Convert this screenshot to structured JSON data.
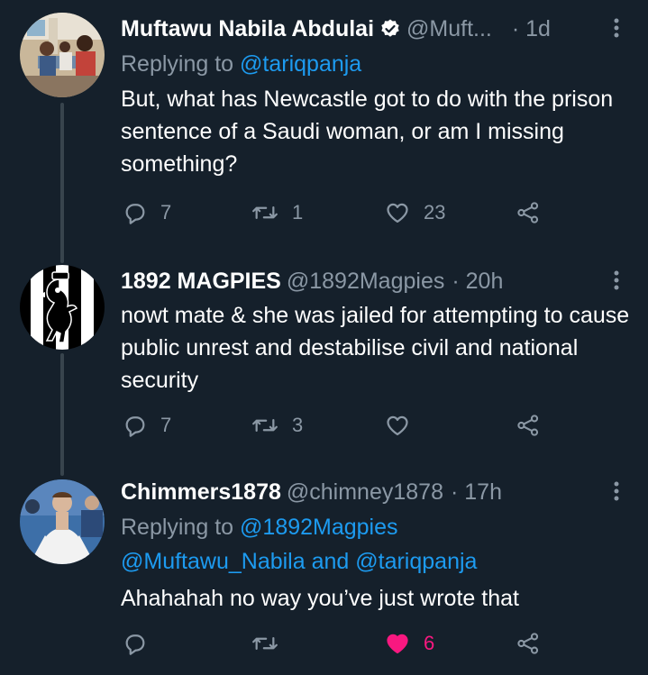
{
  "tweets": [
    {
      "name": "Muftawu Nabila Abdulai",
      "handle": "@Muft...",
      "time": "· 1d",
      "verified": true,
      "reply_prefix": "Replying to ",
      "reply_to": "@tariqpanja",
      "text": "But, what has Newcastle got to do with the prison sentence of a Saudi woman, or am I missing something?",
      "replies": "7",
      "retweets": "1",
      "likes": "23",
      "liked": false
    },
    {
      "name": "1892 MAGPIES",
      "handle": "@1892Magpies",
      "time": "· 20h",
      "verified": false,
      "text": "nowt mate & she was jailed for attempting to cause public unrest and destabilise civil and national security",
      "replies": "7",
      "retweets": "3",
      "likes": "",
      "liked": false
    },
    {
      "name": "Chimmers1878",
      "handle": "@chimney1878",
      "time": "· 17h",
      "verified": false,
      "reply_prefix": "Replying to ",
      "reply_to": "@1892Magpies",
      "reply_to_2": "@Muftawu_Nabila",
      "reply_and": " and ",
      "reply_to_3": "@tariqpanja",
      "text": "Ahahahah no way you’ve just wrote that",
      "replies": "",
      "retweets": "",
      "likes": "6",
      "liked": true
    }
  ],
  "colors": {
    "background": "#15202b",
    "secondary_text": "#8b98a5",
    "link": "#1d9bf0",
    "like_active": "#f91880",
    "thread_line": "#38444d"
  },
  "icons": [
    "verified-badge-icon",
    "more-icon",
    "reply-icon",
    "retweet-icon",
    "like-icon",
    "share-icon"
  ]
}
